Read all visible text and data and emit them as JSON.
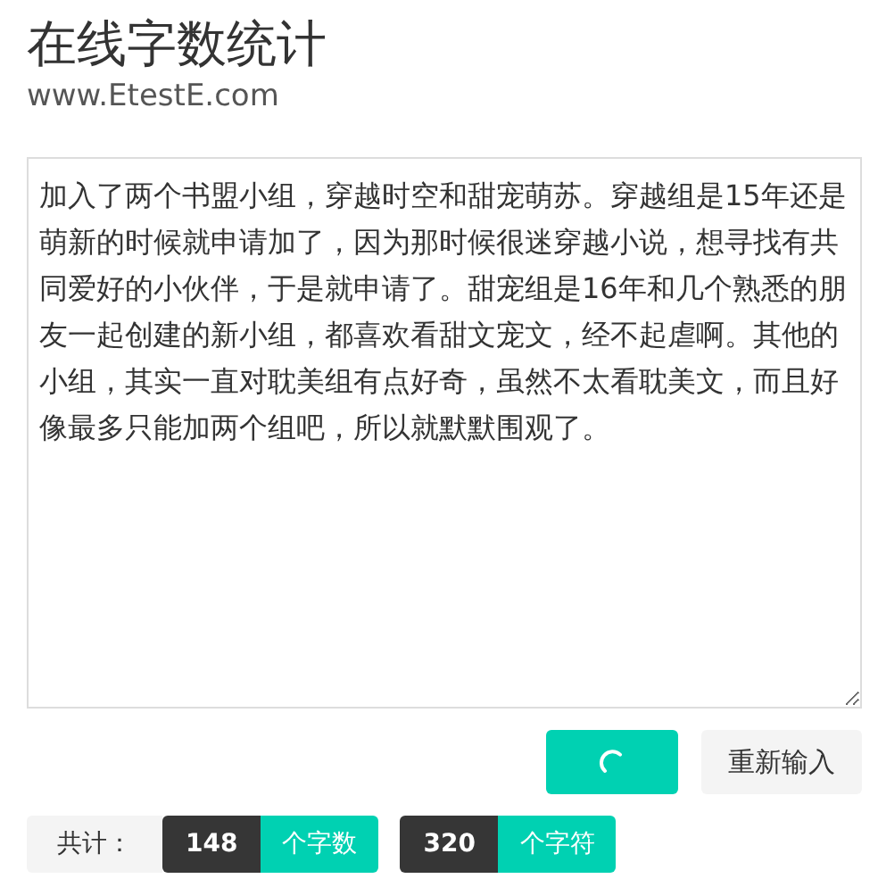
{
  "header": {
    "title": "在线字数统计",
    "site": "www.EtestE.com"
  },
  "editor": {
    "value": "加入了两个书盟小组，穿越时空和甜宠萌苏。穿越组是15年还是萌新的时候就申请加了，因为那时候很迷穿越小说，想寻找有共同爱好的小伙伴，于是就申请了。甜宠组是16年和几个熟悉的朋友一起创建的新小组，都喜欢看甜文宠文，经不起虐啊。其他的小组，其实一直对耽美组有点好奇，虽然不太看耽美文，而且好像最多只能加两个组吧，所以就默默围观了。"
  },
  "actions": {
    "submit": {
      "loading": true
    },
    "reset": "重新输入"
  },
  "stats": {
    "label": "共计：",
    "counts": [
      {
        "value": "148",
        "unit": "个字数"
      },
      {
        "value": "320",
        "unit": "个字符"
      }
    ]
  }
}
